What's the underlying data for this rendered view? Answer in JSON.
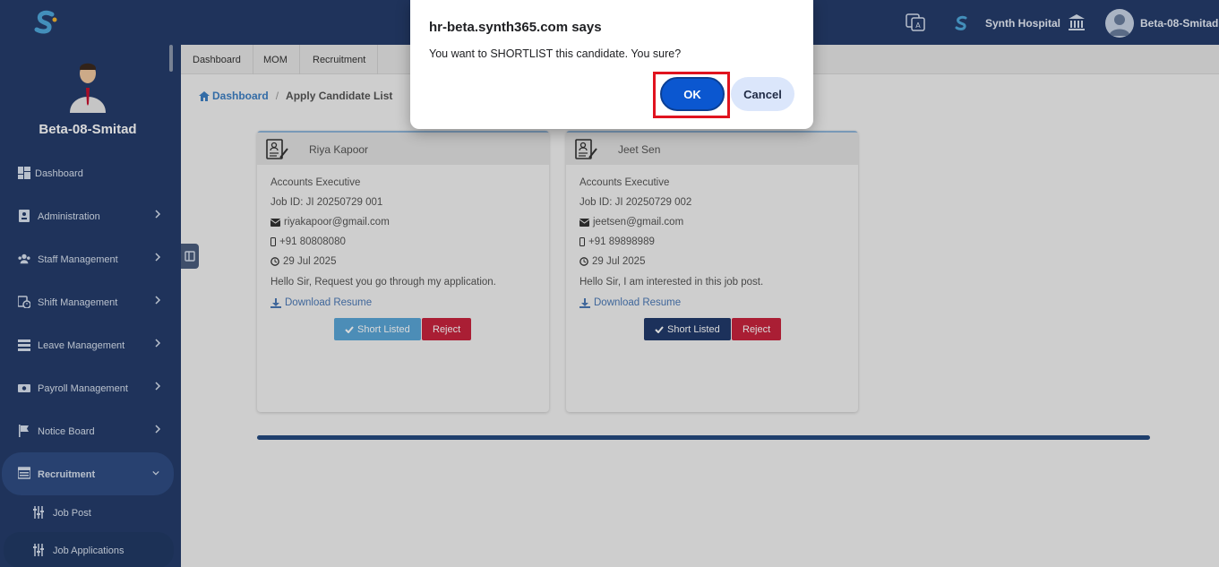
{
  "topbar": {
    "hospital_name": "Synth Hospital",
    "user_name": "Beta-08-Smitad ▾"
  },
  "sidebar": {
    "profile_name": "Beta-08-Smitad",
    "items": [
      {
        "label": "Dashboard",
        "icon": "dashboard-icon"
      },
      {
        "label": "Administration",
        "icon": "id-card-icon"
      },
      {
        "label": "Staff Management",
        "icon": "users-icon"
      },
      {
        "label": "Shift Management",
        "icon": "calendar-clock-icon"
      },
      {
        "label": "Leave Management",
        "icon": "list-icon"
      },
      {
        "label": "Payroll Management",
        "icon": "money-icon"
      },
      {
        "label": "Notice Board",
        "icon": "flag-icon"
      },
      {
        "label": "Recruitment",
        "icon": "recruitment-icon"
      }
    ],
    "sub_items": [
      {
        "label": "Job Post",
        "icon": "sliders-icon"
      },
      {
        "label": "Job Applications",
        "icon": "sliders-icon"
      }
    ]
  },
  "tabs": [
    "Dashboard",
    "MOM",
    "Recruitment"
  ],
  "breadcrumb": {
    "home": "Dashboard",
    "separator": "/",
    "current": "Apply Candidate List"
  },
  "candidates": [
    {
      "name": "Riya Kapoor",
      "position": "Accounts Executive",
      "job_id": "Job ID: JI 20250729 001",
      "email": "riyakapoor@gmail.com",
      "phone": "+91 80808080",
      "date": "29 Jul 2025",
      "message": "Hello Sir, Request you go through my application.",
      "download": "Download Resume",
      "shortlist_label": "Short Listed",
      "reject_label": "Reject",
      "shortlist_color": "#5aa6d8"
    },
    {
      "name": "Jeet Sen",
      "position": "Accounts Executive",
      "job_id": "Job ID: JI 20250729 002",
      "email": "jeetsen@gmail.com",
      "phone": "+91 89898989",
      "date": "29 Jul 2025",
      "message": "Hello Sir, I am interested in this job post.",
      "download": "Download Resume",
      "shortlist_label": "Short Listed",
      "reject_label": "Reject",
      "shortlist_color": "#223a6b"
    }
  ],
  "dialog": {
    "title": "hr-beta.synth365.com says",
    "message": "You want to SHORTLIST this candidate. You sure?",
    "ok_label": "OK",
    "cancel_label": "Cancel"
  },
  "colors": {
    "navbar": "#253d6b",
    "accent": "#0b57d0",
    "reject": "#c8243e",
    "highlight": "#e0131f"
  }
}
